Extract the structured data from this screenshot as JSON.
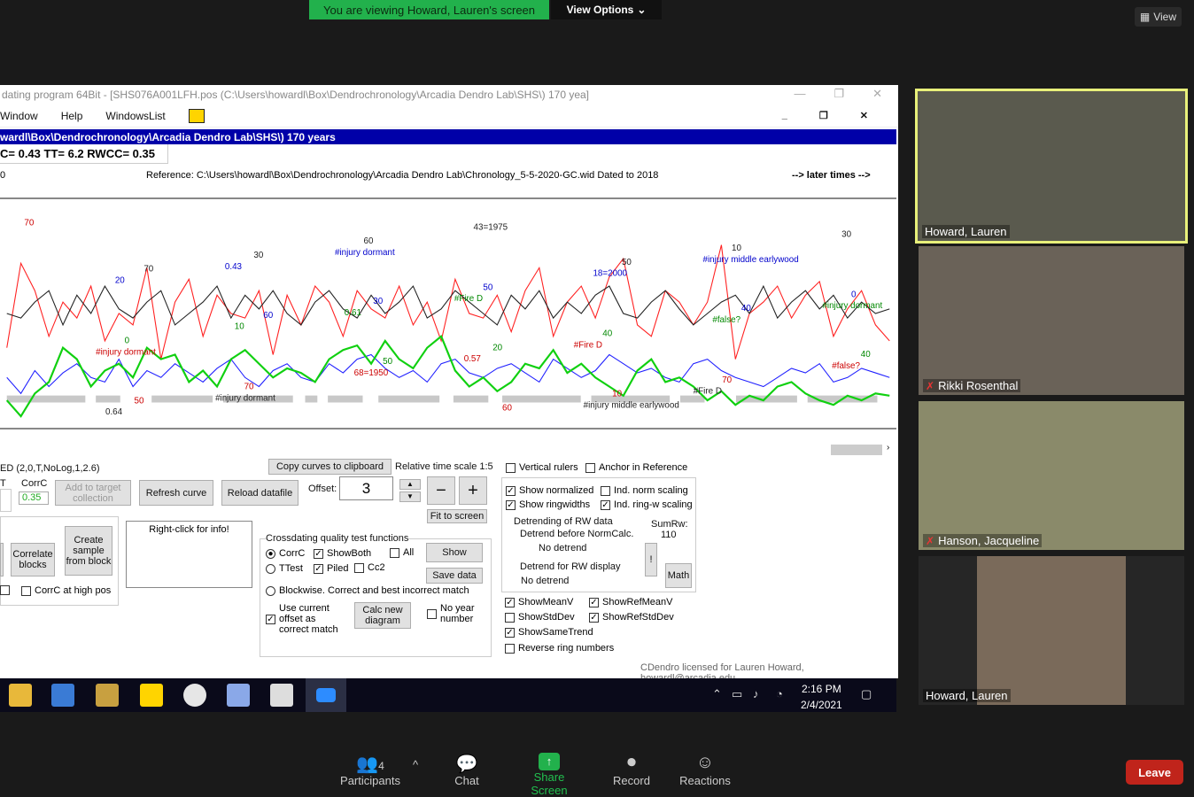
{
  "zoom": {
    "banner": "You are viewing Howard, Lauren's screen",
    "view_options": "View Options",
    "view": "View",
    "participants_count": "4",
    "toolbar": [
      {
        "key": "participants",
        "label": "Participants"
      },
      {
        "key": "chat",
        "label": "Chat"
      },
      {
        "key": "share",
        "label": "Share Screen"
      },
      {
        "key": "record",
        "label": "Record"
      },
      {
        "key": "reactions",
        "label": "Reactions"
      }
    ],
    "leave": "Leave",
    "participants": [
      {
        "name": "Howard, Lauren",
        "muted": false,
        "active": true
      },
      {
        "name": "Rikki Rosenthal",
        "muted": true,
        "active": false
      },
      {
        "name": "Hanson, Jacqueline",
        "muted": true,
        "active": false
      },
      {
        "name": "Howard, Lauren",
        "muted": false,
        "active": false
      }
    ]
  },
  "app": {
    "title": "dating program  64Bit - [SHS076A001LFH.pos    (C:\\Users\\howardl\\Box\\Dendrochronology\\Arcadia Dendro Lab\\SHS\\)  170 yea]",
    "menu": [
      "Window",
      "Help",
      "WindowsList"
    ],
    "path_bar": "wardl\\Box\\Dendrochronology\\Arcadia Dendro Lab\\SHS\\)  170 years",
    "stats": "C= 0.43  TT= 6.2  RWCC= 0.35",
    "ref_zero": "0",
    "reference": "Reference: C:\\Users\\howardl\\Box\\Dendrochronology\\Arcadia Dendro Lab\\Chronology_5-5-2020-GC.wid   Dated to 2018",
    "later_times": "--> later times -->",
    "license": "CDendro licensed for Lauren Howard, howardl@arcadia.edu"
  },
  "controls": {
    "ed_label": "ED (2,0,T,NoLog,1,2.6)",
    "t_label": "T",
    "corrc_label": "CorrC",
    "corrc_value": "0.35",
    "add_target": "Add to target collection",
    "refresh_curve": "Refresh curve",
    "reload_datafile": "Reload datafile",
    "copy_curves": "Copy curves to clipboard",
    "relative_scale": "Relative time scale 1:5",
    "offset_label": "Offset:",
    "offset_value": "3",
    "fit_to_screen": "Fit to screen",
    "correlate_blocks": "Correlate blocks",
    "create_sample": "Create sample from block",
    "corrc_high": "CorrC at high pos",
    "right_click": "Right-click for info!",
    "crossdating_title": "Crossdating quality test functions",
    "corrc_radio": "CorrC",
    "ttest_radio": "TTest",
    "showboth": "ShowBoth",
    "piled": "Piled",
    "all": "All",
    "cc2": "Cc2",
    "show": "Show",
    "save_data": "Save data",
    "blockwise": "Blockwise. Correct and best incorrect match",
    "use_current": "Use current offset as correct match",
    "calc_new": "Calc new diagram",
    "no_year": "No year number",
    "vertical_rulers": "Vertical rulers",
    "anchor_ref": "Anchor in Reference",
    "show_normalized": "Show normalized",
    "show_ringwidths": "Show ringwidths",
    "ind_norm": "Ind. norm scaling",
    "ind_ringw": "Ind. ring-w scaling",
    "detrending_title": "Detrending of RW data",
    "detrend_before": "Detrend before NormCalc.",
    "no_detrend_1": "No detrend",
    "detrend_display": "Detrend for RW display",
    "no_detrend_2": "No detrend",
    "sumrw_label": "SumRw:",
    "sumrw_value": "110",
    "excl": "!",
    "math": "Math",
    "show_meanv": "ShowMeanV",
    "show_stddev": "ShowStdDev",
    "show_sametrend": "ShowSameTrend",
    "show_refmeanv": "ShowRefMeanV",
    "show_refstddev": "ShowRefStdDev",
    "reverse_ring": "Reverse ring numbers"
  },
  "chart_data": {
    "type": "line",
    "series": [
      {
        "color": "#ff2020",
        "values": [
          35,
          72,
          60,
          40,
          55,
          48,
          62,
          38,
          50,
          45,
          70,
          30,
          55,
          65,
          40,
          58,
          50,
          48,
          60,
          32,
          58,
          45,
          62,
          55,
          40,
          60,
          52,
          48,
          62,
          45,
          55,
          38,
          65,
          50,
          48,
          58,
          42,
          60,
          70,
          40,
          55,
          62,
          48,
          66,
          74,
          45,
          40,
          60,
          55,
          45,
          55,
          80,
          30,
          50,
          55,
          62,
          48,
          58,
          64,
          40,
          52,
          60,
          45,
          38
        ]
      },
      {
        "color": "#222222",
        "values": [
          50,
          48,
          55,
          60,
          45,
          58,
          50,
          62,
          52,
          48,
          55,
          60,
          45,
          50,
          55,
          62,
          48,
          58,
          52,
          60,
          50,
          45,
          55,
          60,
          52,
          48,
          58,
          50,
          55,
          62,
          48,
          52,
          60,
          55,
          50,
          45,
          58,
          52,
          60,
          48,
          55,
          50,
          58,
          62,
          50,
          48,
          55,
          60,
          52,
          45,
          50,
          55,
          58,
          50,
          62,
          48,
          55,
          60,
          52,
          58,
          48,
          55,
          50,
          52
        ]
      },
      {
        "color": "#2020ff",
        "values": [
          22,
          15,
          25,
          18,
          24,
          28,
          22,
          20,
          30,
          18,
          25,
          22,
          28,
          24,
          20,
          26,
          30,
          22,
          18,
          25,
          28,
          22,
          20,
          28,
          24,
          30,
          32,
          26,
          22,
          25,
          20,
          28,
          30,
          24,
          22,
          26,
          28,
          24,
          20,
          30,
          26,
          22,
          25,
          32,
          28,
          24,
          26,
          22,
          20,
          28,
          30,
          25,
          22,
          20,
          18,
          22,
          26,
          24,
          28,
          20,
          22,
          26,
          24,
          22
        ]
      },
      {
        "color": "#10d010",
        "values": [
          12,
          5,
          15,
          20,
          35,
          30,
          18,
          25,
          28,
          22,
          35,
          30,
          32,
          20,
          25,
          18,
          30,
          34,
          28,
          22,
          26,
          24,
          20,
          30,
          34,
          36,
          28,
          38,
          30,
          26,
          35,
          40,
          25,
          18,
          22,
          16,
          20,
          28,
          26,
          34,
          24,
          28,
          22,
          18,
          14,
          25,
          30,
          20,
          22,
          18,
          12,
          16,
          10,
          14,
          12,
          18,
          20,
          15,
          12,
          10,
          14,
          12,
          15,
          14
        ]
      }
    ],
    "labels": [
      "70",
      "70",
      "60",
      "50",
      "60",
      "50",
      "40",
      "40",
      "50",
      "30",
      "30",
      "20",
      "10",
      "10",
      "0",
      "0",
      "70",
      "60",
      "50",
      "40",
      "70",
      "30",
      "20",
      "10",
      "68=1950",
      "43=1975",
      "18=2000",
      "#false?",
      "#false?",
      "0.64",
      "0.43",
      "0.61",
      "0.57",
      "#injury middle earlywood",
      "#injury middle earlywood",
      "#injury dormant",
      "#injury dormant",
      "#injury dormant",
      "#injury dormant",
      "#Fire D",
      "#Fire D",
      "#Fire D"
    ]
  }
}
